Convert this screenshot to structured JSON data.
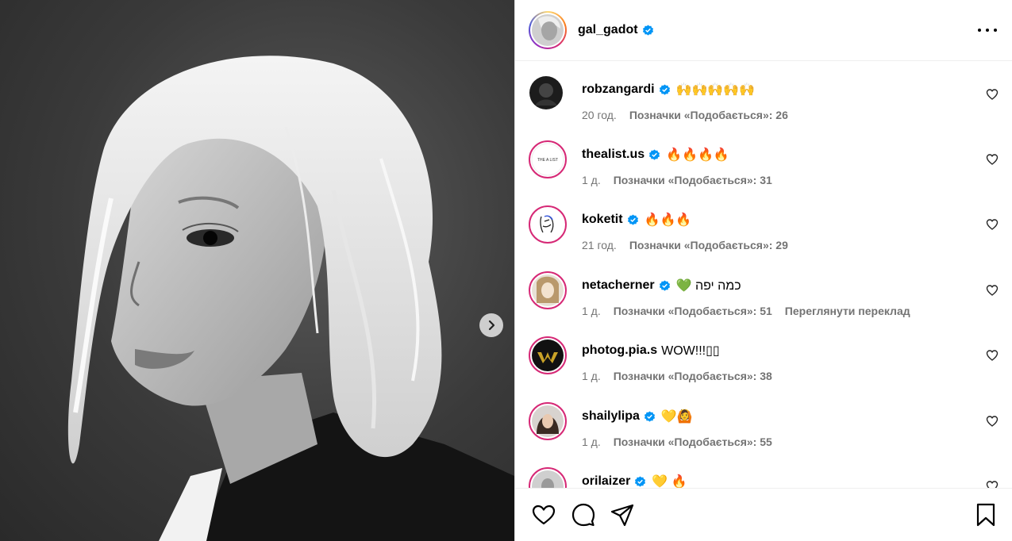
{
  "post": {
    "author": "gal_gadot",
    "verified": true
  },
  "icons": {
    "verified": "verified-badge-icon",
    "more": "more-options-icon",
    "heart": "heart-icon",
    "comment": "comment-icon",
    "share": "share-icon",
    "save": "bookmark-icon",
    "next": "chevron-right-icon"
  },
  "colors": {
    "verified": "#0095f6",
    "meta_text": "#737373"
  },
  "comments": [
    {
      "user": "robzangardi",
      "verified": true,
      "text": "🙌🙌🙌🙌🙌",
      "time": "20 год.",
      "likes": "Позначки «Подобається»: 26"
    },
    {
      "user": "thealist.us",
      "verified": true,
      "text": "🔥🔥🔥🔥",
      "time": "1 д.",
      "likes": "Позначки «Подобається»: 31",
      "avatar_text": "THE A LIST"
    },
    {
      "user": "koketit",
      "verified": true,
      "text": "🔥🔥🔥",
      "time": "21 год.",
      "likes": "Позначки «Подобається»: 29"
    },
    {
      "user": "netacherner",
      "verified": true,
      "text": "💚 כמה יפה",
      "time": "1 д.",
      "likes": "Позначки «Подобається»: 51",
      "translate": "Переглянути переклад"
    },
    {
      "user": "photog.pia.s",
      "verified": false,
      "text": "WOW!!!▯▯",
      "time": "1 д.",
      "likes": "Позначки «Подобається»: 38"
    },
    {
      "user": "shailylipa",
      "verified": true,
      "text": "💛🙆",
      "time": "1 д.",
      "likes": "Позначки «Подобається»: 55"
    },
    {
      "user": "orilaizer",
      "verified": true,
      "text": "💛 🔥",
      "time": "",
      "likes": ""
    }
  ]
}
